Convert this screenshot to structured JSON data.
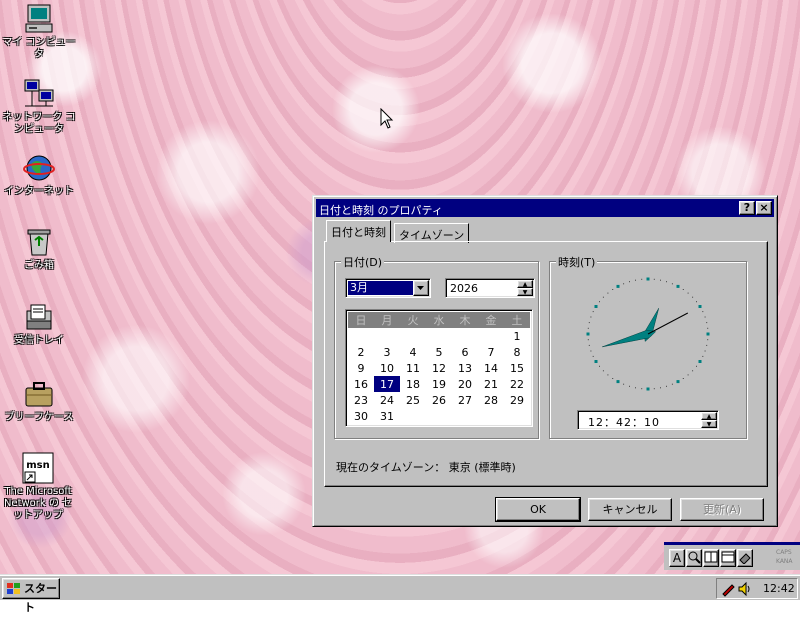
{
  "desktop": {
    "icons": [
      {
        "label": "マイ コンピュータ",
        "icon": "my-computer-icon"
      },
      {
        "label": "ネットワーク コンピュータ",
        "icon": "network-computer-icon"
      },
      {
        "label": "インターネット",
        "icon": "internet-globe-icon"
      },
      {
        "label": "ごみ箱",
        "icon": "recycle-bin-icon"
      },
      {
        "label": "受信トレイ",
        "icon": "inbox-icon"
      },
      {
        "label": "ブリーフケース",
        "icon": "briefcase-icon"
      },
      {
        "label": "The Microsoft Network の セットアップ",
        "icon": "msn-setup-icon"
      }
    ]
  },
  "dialog": {
    "title": "日付と時刻 のプロパティ",
    "help_button": "?",
    "close_button": "×",
    "tabs": [
      {
        "label": "日付と時刻",
        "active": true
      },
      {
        "label": "タイムゾーン",
        "active": false
      }
    ],
    "date_group": {
      "label": "日付(D)",
      "month_value": "3月",
      "year_value": "2026",
      "weekday_headers": [
        "日",
        "月",
        "火",
        "水",
        "木",
        "金",
        "土"
      ],
      "weeks": [
        [
          "",
          "",
          "",
          "",
          "",
          "",
          "1"
        ],
        [
          "2",
          "3",
          "4",
          "5",
          "6",
          "7",
          "8"
        ],
        [
          "9",
          "10",
          "11",
          "12",
          "13",
          "14",
          "15"
        ],
        [
          "16",
          "17",
          "18",
          "19",
          "20",
          "21",
          "22"
        ],
        [
          "23",
          "24",
          "25",
          "26",
          "27",
          "28",
          "29"
        ],
        [
          "30",
          "31",
          "",
          "",
          "",
          "",
          ""
        ]
      ],
      "selected_day": "17"
    },
    "time_group": {
      "label": "時刻(T)",
      "time_value": "12：42：10",
      "clock": {
        "hour": 12,
        "minute": 42,
        "second": 10
      }
    },
    "timezone_line": "現在のタイムゾーン： 東京 (標準時)",
    "buttons": {
      "ok": "OK",
      "cancel": "キャンセル",
      "apply": "更新(A)"
    }
  },
  "ime_toolbar": {
    "mode": "A",
    "caps": "CAPS",
    "kana": "KANA"
  },
  "taskbar": {
    "start_label": "スタート",
    "clock": "12:42"
  },
  "colors": {
    "title_bar": "#000080",
    "selection": "#000080",
    "clock_hands": "#008080",
    "face": "#c0c0c0"
  }
}
